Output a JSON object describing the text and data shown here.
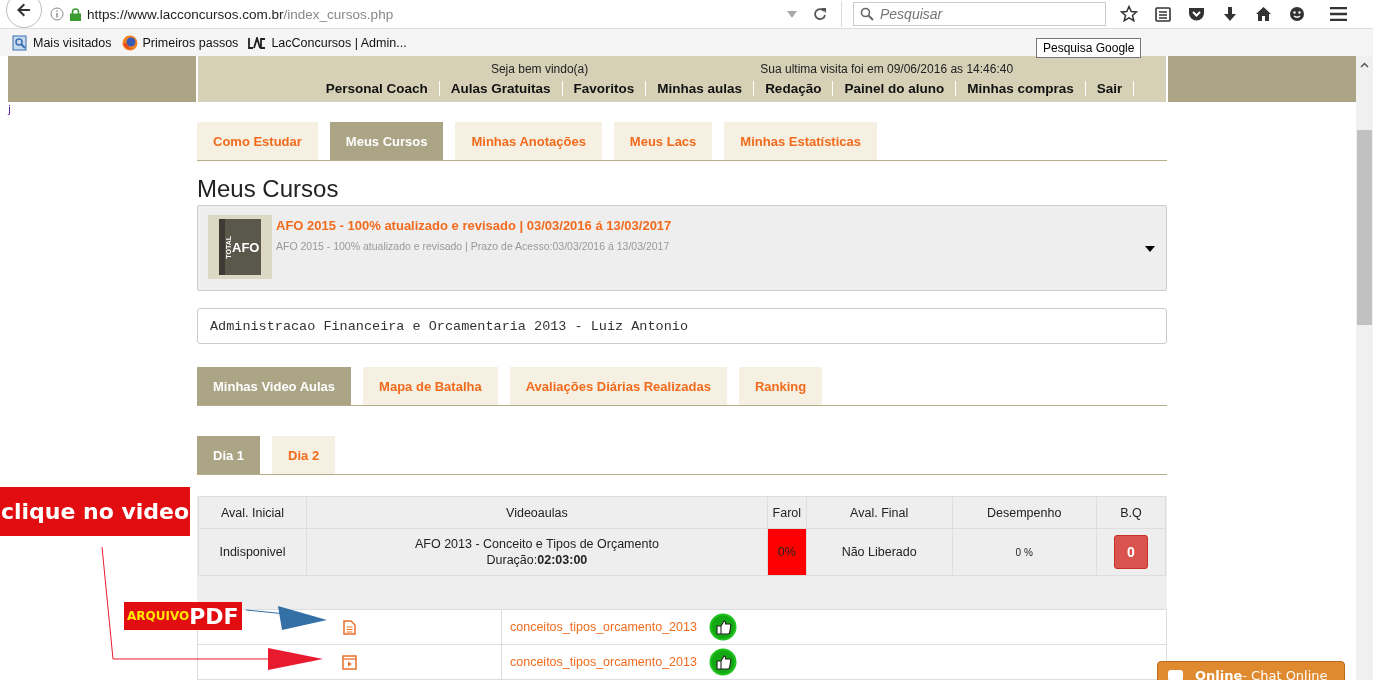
{
  "browser": {
    "url_host": "https://www.lacconcursos.com.br",
    "url_path": "/index_cursos.php",
    "search_placeholder": "Pesquisar",
    "tooltip": "Pesquisa Google",
    "bookmarks": [
      {
        "label": "Mais visitados",
        "kind": "folder"
      },
      {
        "label": "Primeiros passos",
        "kind": "globe"
      },
      {
        "label": "LacConcursos | Admin...",
        "kind": "lac"
      }
    ]
  },
  "header": {
    "welcome": "Seja bem vindo(a)",
    "last_visit": "Sua ultima visita foi em 09/06/2016 as 14:46:40",
    "menu": [
      "Personal Coach",
      "Aulas Gratuitas",
      "Favoritos",
      "Minhas aulas",
      "Redação",
      "Painel do aluno",
      "Minhas compras",
      "Sair"
    ]
  },
  "stray_text": "j",
  "main_tabs": [
    {
      "label": "Como Estudar",
      "selected": false
    },
    {
      "label": "Meus Cursos",
      "selected": true
    },
    {
      "label": "Minhas Anotações",
      "selected": false
    },
    {
      "label": "Meus Lacs",
      "selected": false
    },
    {
      "label": "Minhas Estatísticas",
      "selected": false
    }
  ],
  "page_title": "Meus Cursos",
  "course": {
    "cover_title": "AFO",
    "cover_band": "TOTAL",
    "title": "AFO 2015 - 100% atualizado e revisado | 03/03/2016 á 13/03/2017",
    "subtitle": "AFO 2015 - 100% atualizado e revisado | Prazo de Acesso:03/03/2016 á 13/03/2017"
  },
  "subject": "Administracao Financeira e Orcamentaria 2013 - Luiz Antonio",
  "section_tabs": [
    {
      "label": "Minhas Video Aulas",
      "selected": true
    },
    {
      "label": "Mapa de Batalha",
      "selected": false
    },
    {
      "label": "Avaliações Diárias Realizadas",
      "selected": false
    },
    {
      "label": "Ranking",
      "selected": false
    }
  ],
  "day_tabs": [
    {
      "label": "Dia 1",
      "selected": true
    },
    {
      "label": "Dia 2",
      "selected": false
    }
  ],
  "table": {
    "columns": [
      "Aval. Inicial",
      "Videoaulas",
      "Farol",
      "Aval. Final",
      "Desempenho",
      "B.Q"
    ],
    "row": {
      "aval_inicial": "Indisponivel",
      "lesson": "AFO 2013 - Conceito e Tipos de Orçamento",
      "duration_label": "Duração:",
      "duration": "02:03:00",
      "farol": "0%",
      "aval_final": "Não Liberado",
      "desempenho": "0 %",
      "bq": "0"
    }
  },
  "files": [
    {
      "kind": "pdf",
      "name": "conceitos_tipos_orcamento_2013"
    },
    {
      "kind": "video",
      "name": "conceitos_tipos_orcamento_2013"
    }
  ],
  "annotations": {
    "video_note": "clique no video",
    "pdf_note_small": "ARQUIVO",
    "pdf_note_big": "PDF"
  },
  "chat": {
    "status": "Online",
    "label": " - Chat Online"
  }
}
